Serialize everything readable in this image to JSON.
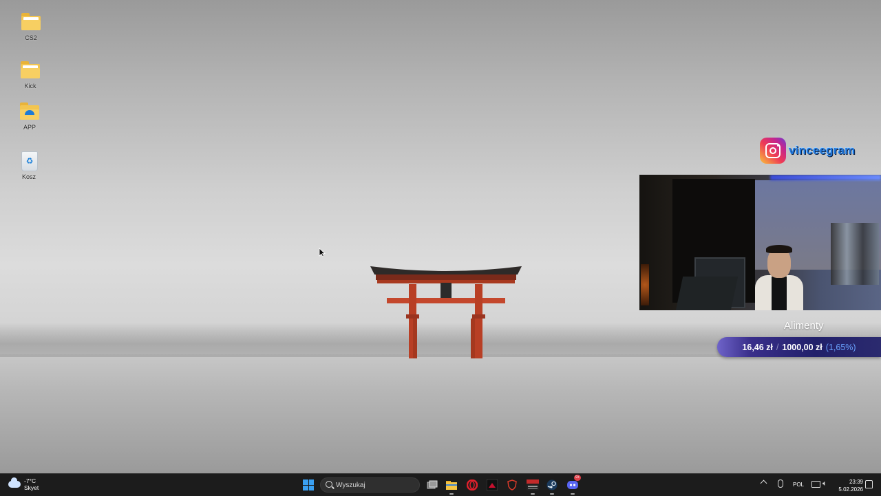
{
  "desktop": {
    "icons": [
      {
        "label": "CS2",
        "icon": "folder-icon"
      },
      {
        "label": "Kick",
        "icon": "folder-icon"
      },
      {
        "label": "APP",
        "icon": "folder-app-icon"
      },
      {
        "label": "Kosz",
        "icon": "recycle-bin-icon"
      }
    ]
  },
  "overlay": {
    "instagram": {
      "handle": "vinceegram",
      "icon": "instagram-icon"
    },
    "goal": {
      "title": "Alimenty",
      "current": "16,46 zł",
      "separator": "/",
      "target": "1000,00 zł",
      "percent": "(1,65%)",
      "progress_fraction": 0.0165
    },
    "webcam": {
      "icon": "webcam-feed"
    }
  },
  "taskbar": {
    "weather": {
      "temperature": "-7°C",
      "condition": "Skyet",
      "icon": "cloud-icon"
    },
    "search": {
      "placeholder": "Wyszukaj"
    },
    "apps": [
      {
        "name": "start",
        "icon": "windows-start-icon"
      },
      {
        "name": "task-view",
        "icon": "task-view-icon"
      },
      {
        "name": "file-explorer",
        "icon": "folder-icon"
      },
      {
        "name": "opera",
        "icon": "opera-icon"
      },
      {
        "name": "app-dark",
        "icon": "dark-app-icon"
      },
      {
        "name": "shield-app",
        "icon": "shield-icon"
      },
      {
        "name": "voicemeeter",
        "icon": "voicemeeter-icon"
      },
      {
        "name": "steam",
        "icon": "steam-icon"
      },
      {
        "name": "discord",
        "icon": "discord-icon",
        "badge": "9+"
      }
    ],
    "tray": {
      "language": "POL",
      "time": "23:39",
      "date": "5.02.2026"
    }
  },
  "colors": {
    "taskbar_bg": "#1c1c1c",
    "windows_blue": "#3aa0f2",
    "goal_bar": "#21206a",
    "goal_percent": "#6aa3ff",
    "instagram_text": "#1e74d9",
    "torii_red": "#c4472c"
  }
}
